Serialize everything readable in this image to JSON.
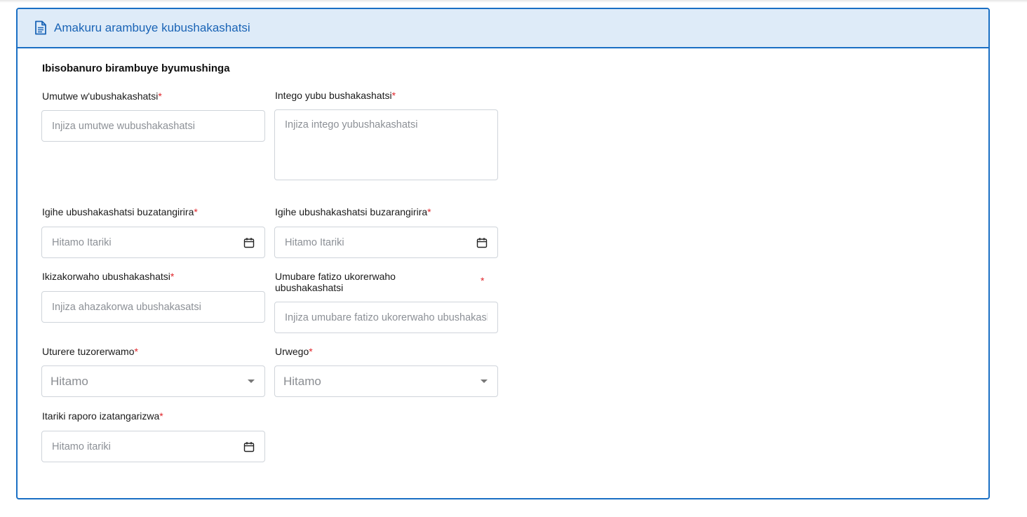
{
  "card": {
    "title": "Amakuru arambuye kubushakashatsi",
    "icon": "document-icon"
  },
  "section_title": "Ibisobanuro birambuye byumushinga",
  "required_mark": "*",
  "fields": {
    "title": {
      "label": "Umutwe w'ubushakashatsi",
      "placeholder": "Injiza umutwe wubushakashatsi"
    },
    "objective": {
      "label": "Intego yubu bushakashatsi",
      "placeholder": "Injiza intego yubushakashatsi"
    },
    "start_date": {
      "label": "Igihe ubushakashatsi buzatangirira",
      "placeholder": "Hitamo Itariki",
      "icon": "calendar-icon"
    },
    "end_date": {
      "label": "Igihe ubushakashatsi buzarangirira",
      "placeholder": "Hitamo Itariki",
      "icon": "calendar-icon"
    },
    "target": {
      "label": "Ikizakorwaho ubushakashatsi",
      "placeholder": "Injiza ahazakorwa ubushakasatsi"
    },
    "sample_size": {
      "label_line1": "Umubare fatizo ukorerwaho",
      "label_line2": "ubushakashatsi",
      "placeholder": "Injiza umubare fatizo ukorerwaho ubushakashatsi"
    },
    "location": {
      "label": "Uturere tuzorerwamo",
      "selected": "Hitamo"
    },
    "level": {
      "label": "Urwego",
      "selected": "Hitamo"
    },
    "report_date": {
      "label": "Itariki raporo izatangarizwa",
      "placeholder": "Hitamo itariki",
      "icon": "calendar-icon"
    }
  },
  "colors": {
    "accent": "#1a6fc4",
    "header_bg": "#deebf8",
    "required": "#e0262b"
  }
}
